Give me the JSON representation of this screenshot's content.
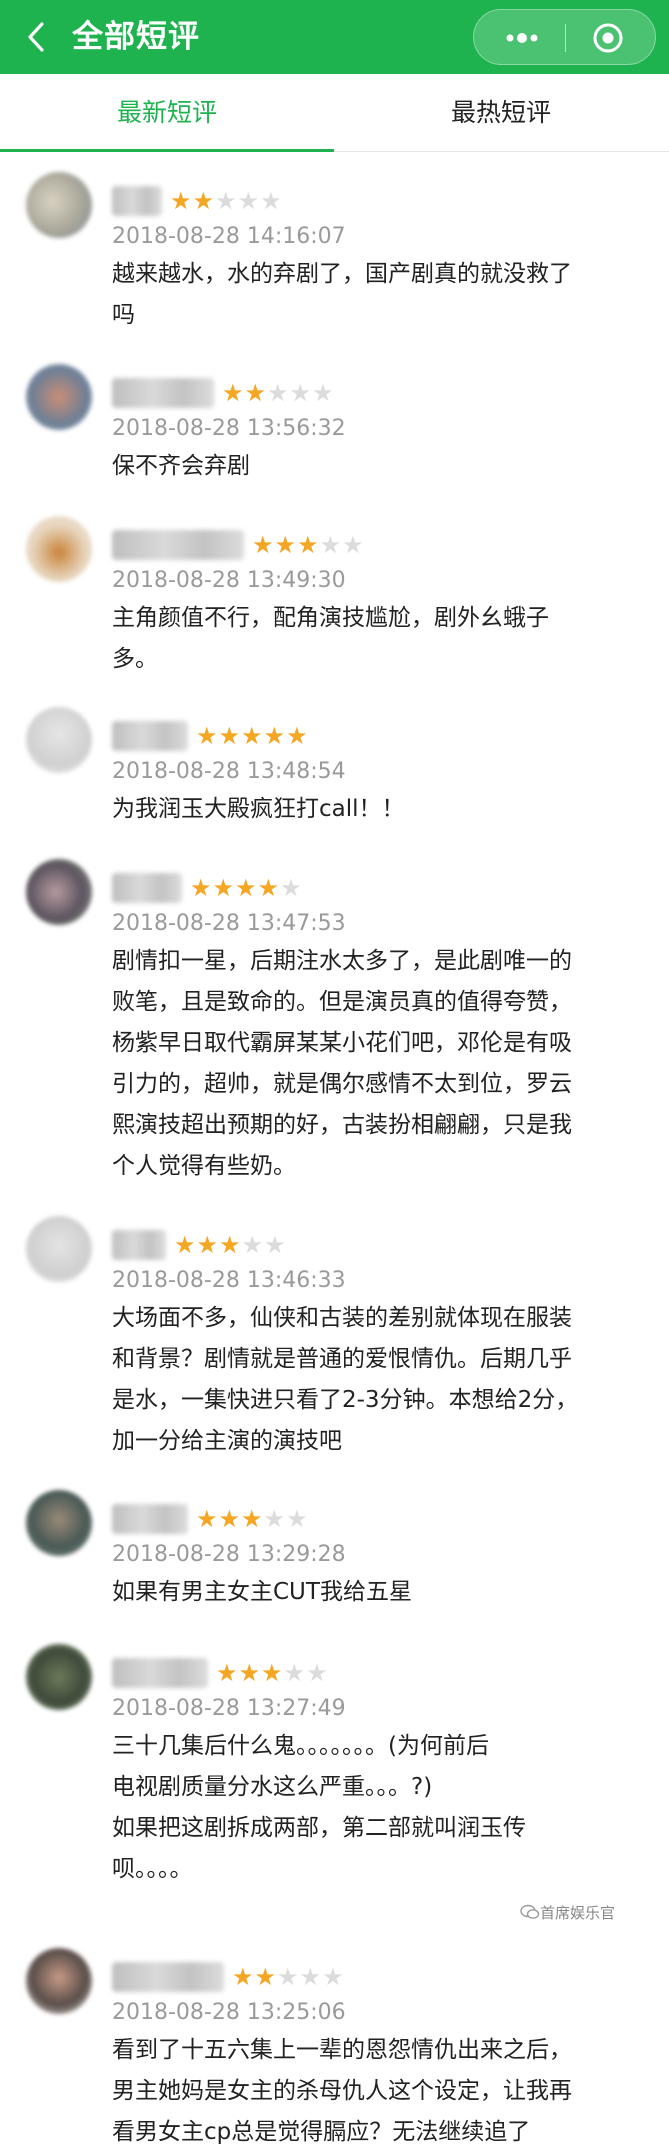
{
  "header": {
    "title": "全部短评",
    "back_icon": "chevron-left-icon",
    "more_icon": "more-dots-icon",
    "target_icon": "target-icon",
    "bg_color": "#1fb34f"
  },
  "tabs": [
    {
      "label": "最新短评",
      "active": true
    },
    {
      "label": "最热短评",
      "active": false
    }
  ],
  "accent_color": "#1fb34f",
  "star_color": "#f5a623",
  "reviews": [
    {
      "rating": 2,
      "time": "2018-08-28 14:16:07",
      "text": "越来越水，水的弃剧了，国产剧真的就没救了\n吗"
    },
    {
      "rating": 2,
      "time": "2018-08-28 13:56:32",
      "text": "保不齐会弃剧"
    },
    {
      "rating": 3,
      "time": "2018-08-28 13:49:30",
      "text": "主角颜值不行，配角演技尴尬，剧外幺蛾子\n多。"
    },
    {
      "rating": 5,
      "time": "2018-08-28 13:48:54",
      "text": "为我润玉大殿疯狂打call！！"
    },
    {
      "rating": 4,
      "time": "2018-08-28 13:47:53",
      "text": "剧情扣一星，后期注水太多了，是此剧唯一的\n败笔，且是致命的。但是演员真的值得夸赞，\n杨紫早日取代霸屏某某小花们吧，邓伦是有吸\n引力的，超帅，就是偶尔感情不太到位，罗云\n熙演技超出预期的好，古装扮相翩翩，只是我\n个人觉得有些奶。"
    },
    {
      "rating": 3,
      "time": "2018-08-28 13:46:33",
      "text": "大场面不多，仙侠和古装的差别就体现在服装\n和背景？剧情就是普通的爱恨情仇。后期几乎\n是水，一集快进只看了2-3分钟。本想给2分，\n加一分给主演的演技吧"
    },
    {
      "rating": 3,
      "time": "2018-08-28 13:29:28",
      "text": "如果有男主女主CUT我给五星"
    },
    {
      "rating": 3,
      "time": "2018-08-28 13:27:49",
      "text": "三十几集后什么鬼。。。。。。。(为何前后\n电视剧质量分水这么严重。。。?)\n如果把这剧拆成两部，第二部就叫润玉传\n呗。。。。"
    },
    {
      "rating": 2,
      "time": "2018-08-28 13:25:06",
      "text": "看到了十五六集上一辈的恩怨情仇出来之后，\n男主她妈是女主的杀母仇人这个设定，让我再\n看男女主cp总是觉得膈应？无法继续追了"
    }
  ],
  "watermark": "首席娱乐官"
}
